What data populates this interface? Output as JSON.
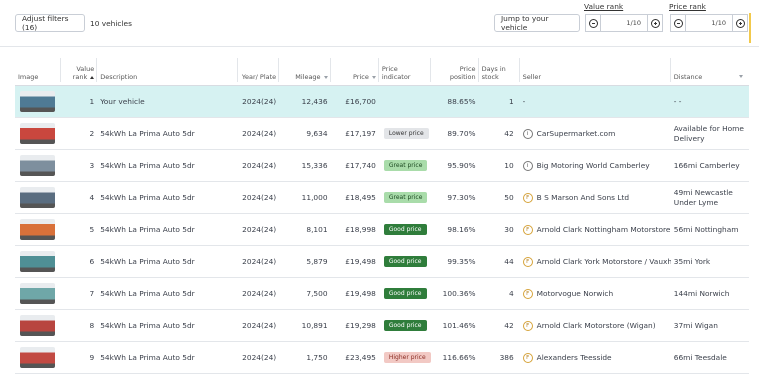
{
  "toolbar": {
    "adjust_filters": "Adjust filters (16)",
    "vehicle_count": "10 vehicles",
    "jump_button": "Jump to your vehicle",
    "value_rank_label": "Value rank",
    "value_rank_value": "1/10",
    "price_rank_label": "Price rank",
    "price_rank_value": "1/10"
  },
  "columns": {
    "image": "Image",
    "value_rank": "Value rank",
    "description": "Description",
    "year_plate": "Year/ Plate",
    "mileage": "Mileage",
    "price": "Price",
    "price_indicator": "Price indicator",
    "price_position": "Price position",
    "days_in_stock": "Days in stock",
    "seller": "Seller",
    "distance": "Distance"
  },
  "rows": [
    {
      "rank": "1",
      "description": "Your vehicle",
      "year": "2024(24)",
      "mileage": "12,436",
      "price": "£16,700",
      "indicator": "",
      "position": "88.65%",
      "days": "1",
      "seller": "-",
      "seller_icon": "",
      "distance": "- -",
      "thumb": "#4f7a94"
    },
    {
      "rank": "2",
      "description": "54kWh La Prima Auto 5dr",
      "year": "2024(24)",
      "mileage": "9,634",
      "price": "£17,197",
      "indicator": "Lower price",
      "indicator_bg": "#e3e5e8",
      "indicator_fg": "#333333",
      "position": "89.70%",
      "days": "42",
      "seller": "CarSupermarket.com",
      "seller_icon": "i",
      "distance": "Available for Home Delivery",
      "thumb": "#c9473e"
    },
    {
      "rank": "3",
      "description": "54kWh La Prima Auto 5dr",
      "year": "2024(24)",
      "mileage": "15,336",
      "price": "£17,740",
      "indicator": "Great price",
      "indicator_bg": "#a9dcaa",
      "indicator_fg": "#1d4a22",
      "position": "95.90%",
      "days": "10",
      "seller": "Big Motoring World Camberley",
      "seller_icon": "i",
      "distance": "166mi Camberley",
      "thumb": "#7e8f9e"
    },
    {
      "rank": "4",
      "description": "54kWh La Prima Auto 5dr",
      "year": "2024(24)",
      "mileage": "11,000",
      "price": "£18,495",
      "indicator": "Great price",
      "indicator_bg": "#a9dcaa",
      "indicator_fg": "#1d4a22",
      "position": "97.30%",
      "days": "50",
      "seller": "B S Marson And Sons Ltd",
      "seller_icon": "F",
      "distance": "49mi Newcastle Under Lyme",
      "thumb": "#5a6d80"
    },
    {
      "rank": "5",
      "description": "54kWh La Prima Auto 5dr",
      "year": "2024(24)",
      "mileage": "8,101",
      "price": "£18,998",
      "indicator": "Good price",
      "indicator_bg": "#2f7d3b",
      "indicator_fg": "#ffffff",
      "position": "98.16%",
      "days": "30",
      "seller": "Arnold Clark Nottingham Motorstore",
      "seller_icon": "F",
      "distance": "56mi Nottingham",
      "thumb": "#d9713a"
    },
    {
      "rank": "6",
      "description": "54kWh La Prima Auto 5dr",
      "year": "2024(24)",
      "mileage": "5,879",
      "price": "£19,498",
      "indicator": "Good price",
      "indicator_bg": "#2f7d3b",
      "indicator_fg": "#ffffff",
      "position": "99.35%",
      "days": "44",
      "seller": "Arnold Clark York Motorstore / Vauxhall",
      "seller_icon": "F",
      "distance": "35mi York",
      "thumb": "#4f8f95"
    },
    {
      "rank": "7",
      "description": "54kWh La Prima Auto 5dr",
      "year": "2024(24)",
      "mileage": "7,500",
      "price": "£19,498",
      "indicator": "Good price",
      "indicator_bg": "#2f7d3b",
      "indicator_fg": "#ffffff",
      "position": "100.36%",
      "days": "4",
      "seller": "Motorvogue Norwich",
      "seller_icon": "F",
      "distance": "144mi Norwich",
      "thumb": "#6fa7a8"
    },
    {
      "rank": "8",
      "description": "54kWh La Prima Auto 5dr",
      "year": "2024(24)",
      "mileage": "10,891",
      "price": "£19,298",
      "indicator": "Good price",
      "indicator_bg": "#2f7d3b",
      "indicator_fg": "#ffffff",
      "position": "101.46%",
      "days": "42",
      "seller": "Arnold Clark Motorstore (Wigan)",
      "seller_icon": "F",
      "distance": "37mi Wigan",
      "thumb": "#b8453f"
    },
    {
      "rank": "9",
      "description": "54kWh La Prima Auto 5dr",
      "year": "2024(24)",
      "mileage": "1,750",
      "price": "£23,495",
      "indicator": "Higher price",
      "indicator_bg": "#f2c9c4",
      "indicator_fg": "#8a2b22",
      "position": "116.66%",
      "days": "386",
      "seller": "Alexanders Teesside",
      "seller_icon": "F",
      "distance": "66mi Teesdale",
      "thumb": "#c24a43"
    }
  ]
}
